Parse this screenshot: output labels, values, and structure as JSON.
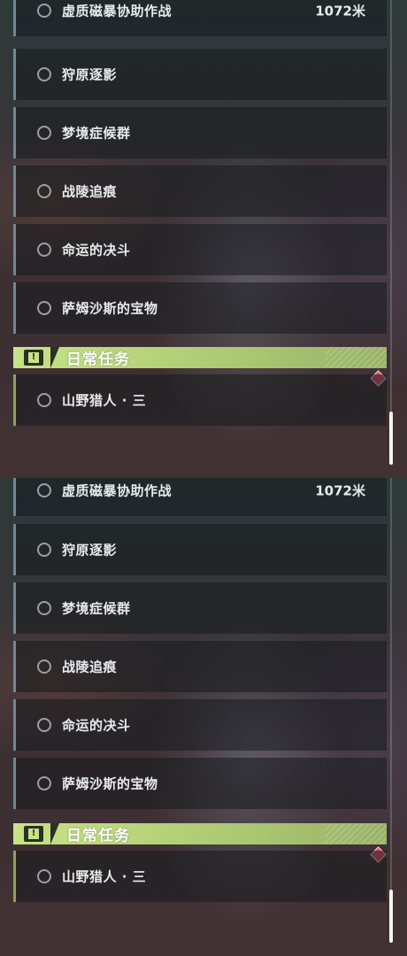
{
  "quests": [
    {
      "name": "虚质磁暴协助作战",
      "distance": "1072米"
    },
    {
      "name": "狩原逐影"
    },
    {
      "name": "梦境症候群"
    },
    {
      "name": "战陵追痕"
    },
    {
      "name": "命运的决斗"
    },
    {
      "name": "萨姆沙斯的宝物"
    }
  ],
  "daily_section": {
    "title": "日常任务",
    "icon": "exclamation-icon",
    "items": [
      {
        "name": "山野猎人 · 三"
      }
    ]
  },
  "colors": {
    "header_green": "#c6e486",
    "quest_border": "#6e8896",
    "daily_border": "#8fa255",
    "marker_red": "#d8526a"
  }
}
